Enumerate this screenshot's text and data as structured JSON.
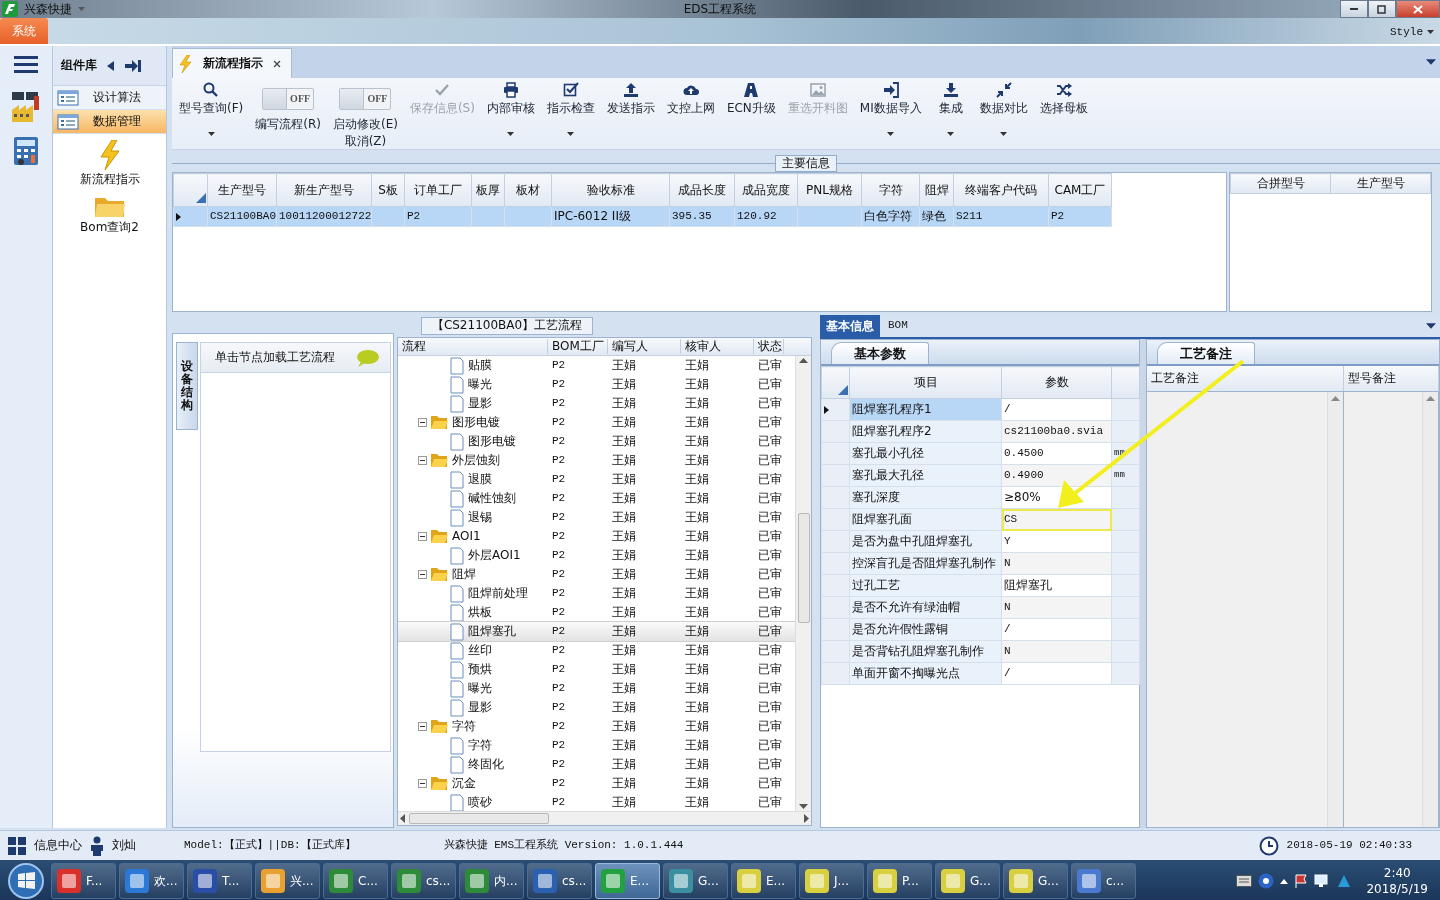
{
  "window": {
    "app_name": "兴森快捷",
    "title": "EDS工程系统"
  },
  "ribbon": {
    "tabs": [
      {
        "label": "系统",
        "selected": true
      }
    ],
    "style_menu": "Style"
  },
  "sidebar": {
    "title": "组件库",
    "groups": [
      {
        "label": "设计算法",
        "selected": false
      },
      {
        "label": "数据管理",
        "selected": true
      }
    ],
    "items": [
      {
        "label": "新流程指示"
      },
      {
        "label": "Bom查询2"
      }
    ]
  },
  "document_tabs": [
    {
      "label": "新流程指示",
      "selected": true
    }
  ],
  "toolbar": [
    {
      "kind": "button",
      "lines": [
        "型号查询(F)"
      ],
      "disabled": false,
      "dropdown": true
    },
    {
      "kind": "toggle",
      "lines": [
        "编写流程(R)"
      ],
      "switch_text": "OFF",
      "on": false
    },
    {
      "kind": "toggle",
      "lines": [
        "启动修改(E)",
        "取消(Z)"
      ],
      "switch_text": "OFF",
      "on": false
    },
    {
      "kind": "button",
      "lines": [
        "保存信息(S)"
      ],
      "disabled": true,
      "dropdown": false
    },
    {
      "kind": "button",
      "lines": [
        "内部审核"
      ],
      "disabled": false,
      "dropdown": true
    },
    {
      "kind": "button",
      "lines": [
        "指示检查"
      ],
      "disabled": false,
      "dropdown": true
    },
    {
      "kind": "button",
      "lines": [
        "发送指示"
      ],
      "disabled": false,
      "dropdown": false
    },
    {
      "kind": "button",
      "lines": [
        "文控上网"
      ],
      "disabled": false,
      "dropdown": false
    },
    {
      "kind": "button",
      "lines": [
        "ECN升级"
      ],
      "disabled": false,
      "dropdown": false
    },
    {
      "kind": "button",
      "lines": [
        "重选开料图"
      ],
      "disabled": true,
      "dropdown": false
    },
    {
      "kind": "button",
      "lines": [
        "MI数据导入"
      ],
      "disabled": false,
      "dropdown": true
    },
    {
      "kind": "button",
      "lines": [
        "集成"
      ],
      "disabled": false,
      "dropdown": true
    },
    {
      "kind": "button",
      "lines": [
        "数据对比"
      ],
      "disabled": false,
      "dropdown": true
    },
    {
      "kind": "button",
      "lines": [
        "选择母板"
      ],
      "disabled": false,
      "dropdown": false
    }
  ],
  "main_info": {
    "title": "主要信息",
    "columns": [
      "生产型号",
      "新生产型号",
      "S板",
      "订单工厂",
      "板厚",
      "板材",
      "验收标准",
      "成品长度",
      "成品宽度",
      "PNL规格",
      "字符",
      "阻焊",
      "终端客户代码",
      "CAM工厂"
    ],
    "rows": [
      {
        "selected": true,
        "cells": [
          "CS21100BA0",
          "10011200012722",
          null,
          "P2",
          null,
          null,
          "IPC-6012 II级",
          "395.35",
          "120.92",
          null,
          "白色字符",
          "绿色",
          "S211",
          "P2"
        ]
      }
    ],
    "side_columns": [
      "合拼型号",
      "生产型号"
    ]
  },
  "device_panel": {
    "tab": "设备结构",
    "hint": "单击节点加载工艺流程"
  },
  "process": {
    "title": "【CS21100BA0】工艺流程",
    "columns": [
      "流程",
      "BOM工厂",
      "编写人",
      "核审人",
      "状态"
    ],
    "nodes": [
      {
        "children": [
          {
            "kind": "file",
            "label": "贴膜",
            "bom_factory": "P2",
            "writer": "王娟",
            "reviewer": "王娟",
            "status": "已审",
            "selected": false
          },
          {
            "kind": "file",
            "label": "曝光",
            "bom_factory": "P2",
            "writer": "王娟",
            "reviewer": "王娟",
            "status": "已审",
            "selected": false
          },
          {
            "kind": "file",
            "label": "显影",
            "bom_factory": "P2",
            "writer": "王娟",
            "reviewer": "王娟",
            "status": "已审",
            "selected": false
          }
        ]
      },
      {
        "kind": "folder",
        "label": "图形电镀",
        "bom_factory": "P2",
        "writer": "王娟",
        "reviewer": "王娟",
        "status": "已审",
        "selected": false,
        "expanded": true,
        "children": [
          {
            "kind": "file",
            "label": "图形电镀",
            "bom_factory": "P2",
            "writer": "王娟",
            "reviewer": "王娟",
            "status": "已审",
            "selected": false
          }
        ]
      },
      {
        "kind": "folder",
        "label": "外层蚀刻",
        "bom_factory": "P2",
        "writer": "王娟",
        "reviewer": "王娟",
        "status": "已审",
        "selected": false,
        "expanded": true,
        "children": [
          {
            "kind": "file",
            "label": "退膜",
            "bom_factory": "P2",
            "writer": "王娟",
            "reviewer": "王娟",
            "status": "已审",
            "selected": false
          },
          {
            "kind": "file",
            "label": "碱性蚀刻",
            "bom_factory": "P2",
            "writer": "王娟",
            "reviewer": "王娟",
            "status": "已审",
            "selected": false
          },
          {
            "kind": "file",
            "label": "退锡",
            "bom_factory": "P2",
            "writer": "王娟",
            "reviewer": "王娟",
            "status": "已审",
            "selected": false
          }
        ]
      },
      {
        "kind": "folder",
        "label": "AOI1",
        "bom_factory": "P2",
        "writer": "王娟",
        "reviewer": "王娟",
        "status": "已审",
        "selected": false,
        "expanded": true,
        "children": [
          {
            "kind": "file",
            "label": "外层AOI1",
            "bom_factory": "P2",
            "writer": "王娟",
            "reviewer": "王娟",
            "status": "已审",
            "selected": false
          }
        ]
      },
      {
        "kind": "folder",
        "label": "阻焊",
        "bom_factory": "P2",
        "writer": "王娟",
        "reviewer": "王娟",
        "status": "已审",
        "selected": false,
        "expanded": true,
        "children": [
          {
            "kind": "file",
            "label": "阻焊前处理",
            "bom_factory": "P2",
            "writer": "王娟",
            "reviewer": "王娟",
            "status": "已审",
            "selected": false
          },
          {
            "kind": "file",
            "label": "烘板",
            "bom_factory": "P2",
            "writer": "王娟",
            "reviewer": "王娟",
            "status": "已审",
            "selected": false
          },
          {
            "kind": "file",
            "label": "阻焊塞孔",
            "bom_factory": "P2",
            "writer": "王娟",
            "reviewer": "王娟",
            "status": "已审",
            "selected": true
          },
          {
            "kind": "file",
            "label": "丝印",
            "bom_factory": "P2",
            "writer": "王娟",
            "reviewer": "王娟",
            "status": "已审",
            "selected": false
          },
          {
            "kind": "file",
            "label": "预烘",
            "bom_factory": "P2",
            "writer": "王娟",
            "reviewer": "王娟",
            "status": "已审",
            "selected": false
          },
          {
            "kind": "file",
            "label": "曝光",
            "bom_factory": "P2",
            "writer": "王娟",
            "reviewer": "王娟",
            "status": "已审",
            "selected": false
          },
          {
            "kind": "file",
            "label": "显影",
            "bom_factory": "P2",
            "writer": "王娟",
            "reviewer": "王娟",
            "status": "已审",
            "selected": false
          }
        ]
      },
      {
        "kind": "folder",
        "label": "字符",
        "bom_factory": "P2",
        "writer": "王娟",
        "reviewer": "王娟",
        "status": "已审",
        "selected": false,
        "expanded": true,
        "children": [
          {
            "kind": "file",
            "label": "字符",
            "bom_factory": "P2",
            "writer": "王娟",
            "reviewer": "王娟",
            "status": "已审",
            "selected": false
          },
          {
            "kind": "file",
            "label": "终固化",
            "bom_factory": "P2",
            "writer": "王娟",
            "reviewer": "王娟",
            "status": "已审",
            "selected": false
          }
        ]
      },
      {
        "kind": "folder",
        "label": "沉金",
        "bom_factory": "P2",
        "writer": "王娟",
        "reviewer": "王娟",
        "status": "已审",
        "selected": false,
        "expanded": true,
        "children": [
          {
            "kind": "file",
            "label": "喷砂",
            "bom_factory": "P2",
            "writer": "王娟",
            "reviewer": "王娟",
            "status": "已审",
            "selected": false
          }
        ]
      }
    ]
  },
  "detail": {
    "tabs": [
      {
        "label": "基本信息",
        "selected": true
      },
      {
        "label": "BOM",
        "selected": false
      }
    ],
    "params": {
      "title": "基本参数",
      "columns": [
        "项目",
        "参数"
      ],
      "rows": [
        {
          "item": "阻焊塞孔程序1",
          "value": "/",
          "selected": true,
          "highlighted": false
        },
        {
          "item": "阻焊塞孔程序2",
          "value": "cs21100ba0.svia",
          "selected": false,
          "highlighted": false
        },
        {
          "item": "塞孔最小孔径",
          "value": "0.4500",
          "unit": "mm",
          "selected": false,
          "highlighted": false
        },
        {
          "item": "塞孔最大孔径",
          "value": "0.4900",
          "unit": "mm",
          "selected": false,
          "highlighted": false
        },
        {
          "item": "塞孔深度",
          "value": "≥80%",
          "selected": false,
          "highlighted": false
        },
        {
          "item": "阻焊塞孔面",
          "value": "CS",
          "selected": false,
          "highlighted": true
        },
        {
          "item": "是否为盘中孔阻焊塞孔",
          "value": "Y",
          "selected": false,
          "highlighted": false
        },
        {
          "item": "控深盲孔是否阻焊塞孔制作",
          "value": "N",
          "selected": false,
          "highlighted": false
        },
        {
          "item": "过孔工艺",
          "value": "阻焊塞孔",
          "selected": false,
          "highlighted": false
        },
        {
          "item": "是否不允许有绿油帽",
          "value": "N",
          "selected": false,
          "highlighted": false
        },
        {
          "item": "是否允许假性露铜",
          "value": "/",
          "selected": false,
          "highlighted": false
        },
        {
          "item": "是否背钻孔阻焊塞孔制作",
          "value": "N",
          "selected": false,
          "highlighted": false
        },
        {
          "item": "单面开窗不掏曝光点",
          "value": "/",
          "selected": false,
          "highlighted": false
        }
      ]
    },
    "notes": {
      "title": "工艺备注",
      "columns": [
        "工艺备注",
        "型号备注"
      ]
    }
  },
  "status_bar": {
    "info_center": "信息中心",
    "user": "刘灿",
    "environment": "Model:【正式】||DB:【正式库】",
    "version": "兴森快捷 EMS工程系统 Version: 1.0.1.444",
    "datetime": "2018-05-19 02:40:33"
  },
  "taskbar": {
    "buttons": [
      {
        "label": "F...",
        "selected": false
      },
      {
        "label": "欢...",
        "selected": false
      },
      {
        "label": "T...",
        "selected": false
      },
      {
        "label": "兴...",
        "selected": false
      },
      {
        "label": "C...",
        "selected": false
      },
      {
        "label": "cs...",
        "selected": false
      },
      {
        "label": "内...",
        "selected": false
      },
      {
        "label": "cs...",
        "selected": false
      },
      {
        "label": "E...",
        "selected": true
      },
      {
        "label": "G...",
        "selected": false
      },
      {
        "label": "E...",
        "selected": false
      },
      {
        "label": "J...",
        "selected": false
      },
      {
        "label": "P...",
        "selected": false
      },
      {
        "label": "G...",
        "selected": false
      },
      {
        "label": "G...",
        "selected": false
      },
      {
        "label": "c...",
        "selected": false
      }
    ],
    "clock_time": "2:40",
    "clock_date": "2018/5/19"
  }
}
